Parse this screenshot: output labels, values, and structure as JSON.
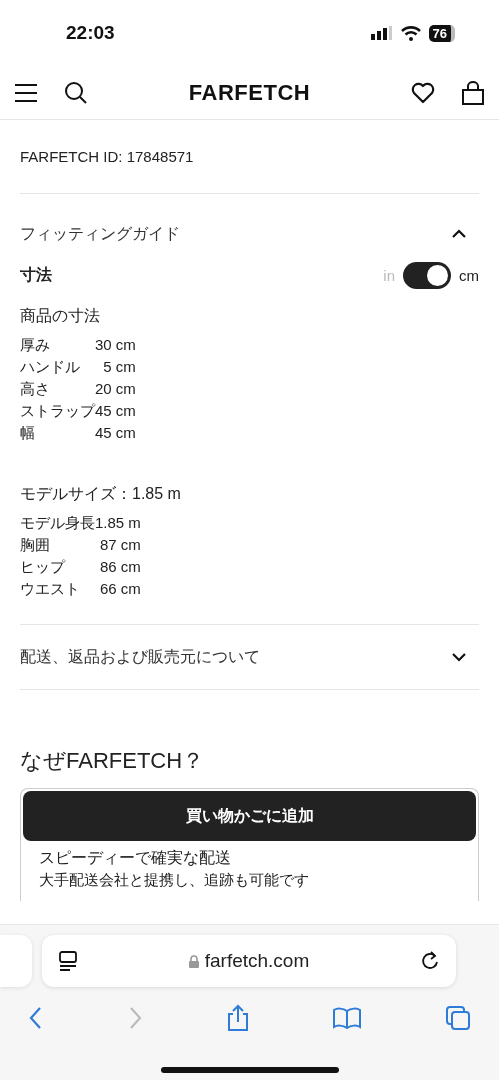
{
  "status_bar": {
    "time": "22:03",
    "battery": "76"
  },
  "header": {
    "logo": "FARFETCH"
  },
  "product_id": "FARFETCH ID: 17848571",
  "fitting_guide": {
    "title": "フィッティングガイド",
    "expanded": true,
    "dimensions_title": "寸法",
    "unit_toggle": {
      "off_label": "in",
      "on_label": "cm",
      "on": true
    },
    "product_title": "商品の寸法",
    "product_rows": [
      {
        "label": "厚み",
        "value": "30 cm"
      },
      {
        "label": "ハンドル",
        "value": "5 cm"
      },
      {
        "label": "高さ",
        "value": "20 cm"
      },
      {
        "label": "ストラップ",
        "value": "45 cm"
      },
      {
        "label": "幅",
        "value": "45 cm"
      }
    ],
    "model_title": "モデルサイズ：1.85 m",
    "model_rows": [
      {
        "label": "モデル身長",
        "value": "1.85 m"
      },
      {
        "label": "胸囲",
        "value": "87 cm"
      },
      {
        "label": "ヒップ",
        "value": "86 cm"
      },
      {
        "label": "ウエスト",
        "value": "66 cm"
      }
    ]
  },
  "shipping": {
    "title": "配送、返品および販売元について",
    "expanded": false
  },
  "why": {
    "title": "なぜFARFETCH？",
    "button": "買い物かごに追加",
    "feature_title": "スピーディーで確実な配送",
    "feature_text": "大手配送会社と提携し、追跡も可能です"
  },
  "browser": {
    "url": "farfetch.com"
  }
}
